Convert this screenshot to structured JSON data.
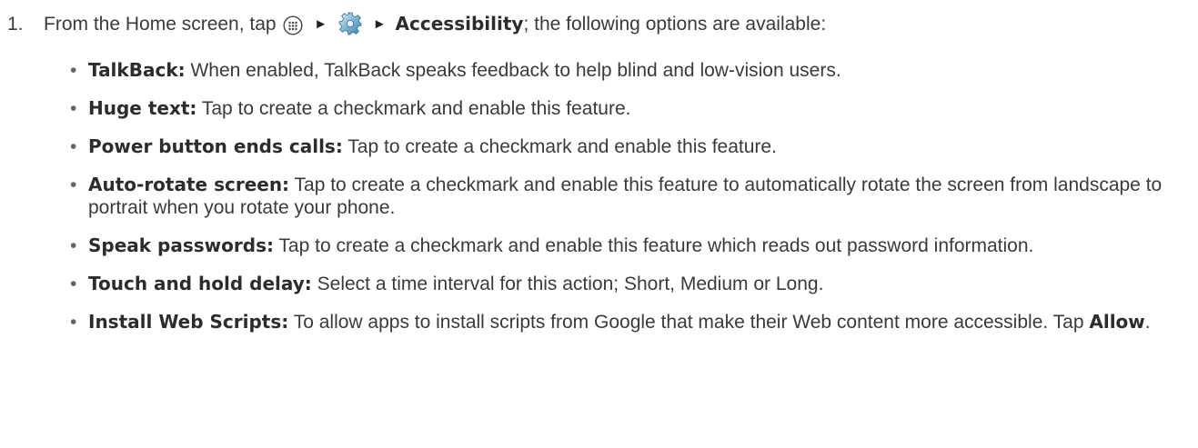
{
  "step": {
    "number": "1.",
    "intro": "From the Home screen, tap",
    "apps_icon": "apps-grid-icon",
    "arrow": "►",
    "settings_icon": "gear-icon",
    "destination": "Accessibility",
    "tail": "; the following options are available:"
  },
  "options": [
    {
      "term": "TalkBack:",
      "text": " When enabled, TalkBack speaks feedback to help blind and low-vision users."
    },
    {
      "term": "Huge text:",
      "text": " Tap to create a checkmark and enable this feature."
    },
    {
      "term": "Power button ends calls:",
      "text": " Tap to create a checkmark and enable this feature."
    },
    {
      "term": "Auto-rotate screen:",
      "text": " Tap to create a checkmark and enable this feature to automatically rotate the screen from landscape to portrait when you rotate your phone."
    },
    {
      "term": "Speak passwords:",
      "text": " Tap to create a checkmark and enable this feature which reads out password information."
    },
    {
      "term": "Touch and hold delay:",
      "text": " Select a time interval for this action; Short, Medium or Long."
    },
    {
      "term": "Install Web Scripts:",
      "text": " To allow apps to install scripts from Google that make their Web content more accessible. Tap ",
      "action": "Allow",
      "end": "."
    }
  ],
  "bullet": "•"
}
